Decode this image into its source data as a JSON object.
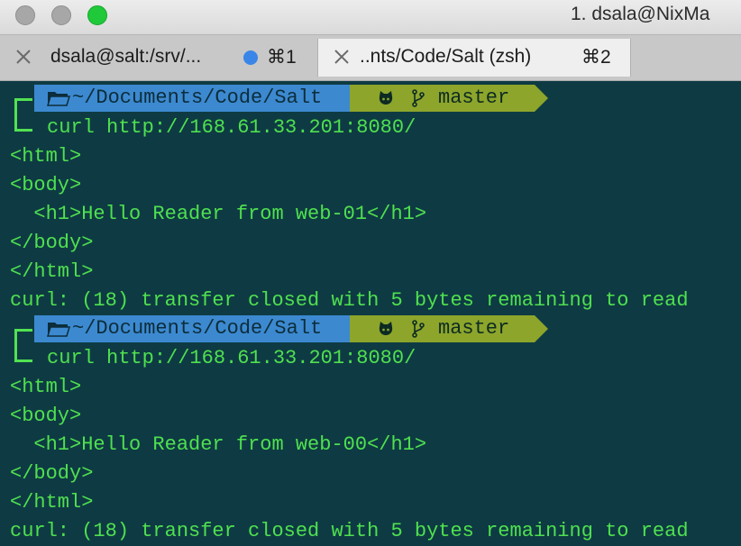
{
  "window": {
    "title": "1. dsala@NixMa"
  },
  "tabs": [
    {
      "label": "dsala@salt:/srv/...",
      "shortcut": "⌘1",
      "active": false,
      "activity_dot": true
    },
    {
      "label": "..nts/Code/Salt (zsh)",
      "shortcut": "⌘2",
      "active": true,
      "activity_dot": false
    }
  ],
  "colors": {
    "terminal_bg": "#0e3b43",
    "terminal_text": "#4fe04f",
    "path_segment": "#3c89d0",
    "git_segment": "#8da52b",
    "activity_dot": "#3a86e8"
  },
  "blocks": [
    {
      "prompt": {
        "path": "~/Documents/Code/Salt",
        "branch": "master",
        "icons": [
          "folder-icon",
          "github-icon",
          "branch-icon"
        ]
      },
      "command": "curl http://168.61.33.201:8080/",
      "output": [
        "<html>",
        "<body>",
        "  <h1>Hello Reader from web-01</h1>",
        "</body>",
        "</html>",
        "curl: (18) transfer closed with 5 bytes remaining to read"
      ]
    },
    {
      "prompt": {
        "path": "~/Documents/Code/Salt",
        "branch": "master",
        "icons": [
          "folder-icon",
          "github-icon",
          "branch-icon"
        ]
      },
      "command": "curl http://168.61.33.201:8080/",
      "output": [
        "<html>",
        "<body>",
        "  <h1>Hello Reader from web-00</h1>",
        "</body>",
        "</html>",
        "curl: (18) transfer closed with 5 bytes remaining to read"
      ]
    }
  ]
}
